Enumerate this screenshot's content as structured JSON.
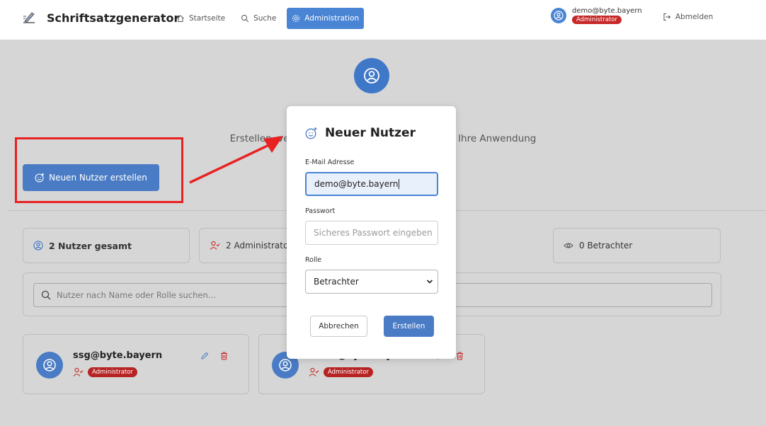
{
  "app": {
    "name": "Schriftsatzgenerator"
  },
  "nav": {
    "items": [
      {
        "label": "Startseite",
        "icon": "home-icon"
      },
      {
        "label": "Suche",
        "icon": "search-icon"
      },
      {
        "label": "Administration",
        "icon": "gear-icon",
        "active": true
      }
    ]
  },
  "user": {
    "email": "demo@byte.bayern",
    "role": "Administrator"
  },
  "logout_label": "Abmelden",
  "hero": {
    "description": "Erstellen, verwalten und löschen Sie Nutzer für Ihre Anwendung"
  },
  "create_button_label": "Neuen Nutzer erstellen",
  "stats": {
    "total": "2 Nutzer gesamt",
    "admins": "2 Administratoren",
    "viewers": "0 Betrachter"
  },
  "search": {
    "placeholder": "Nutzer nach Name oder Rolle suchen..."
  },
  "user_cards": [
    {
      "email": "ssg@byte.bayern",
      "role": "Administrator"
    },
    {
      "email": "demo@byte.bayern",
      "role": "Administrator"
    }
  ],
  "modal": {
    "title": "Neuer Nutzer",
    "email_label": "E-Mail Adresse",
    "email_value": "demo@byte.bayern",
    "password_label": "Passwort",
    "password_placeholder": "Sicheres Passwort eingeben",
    "role_label": "Rolle",
    "role_value": "Betrachter",
    "cancel_label": "Abbrechen",
    "submit_label": "Erstellen"
  },
  "colors": {
    "accent": "#4a84d4",
    "danger": "#c62828",
    "annotation": "#e82222"
  }
}
